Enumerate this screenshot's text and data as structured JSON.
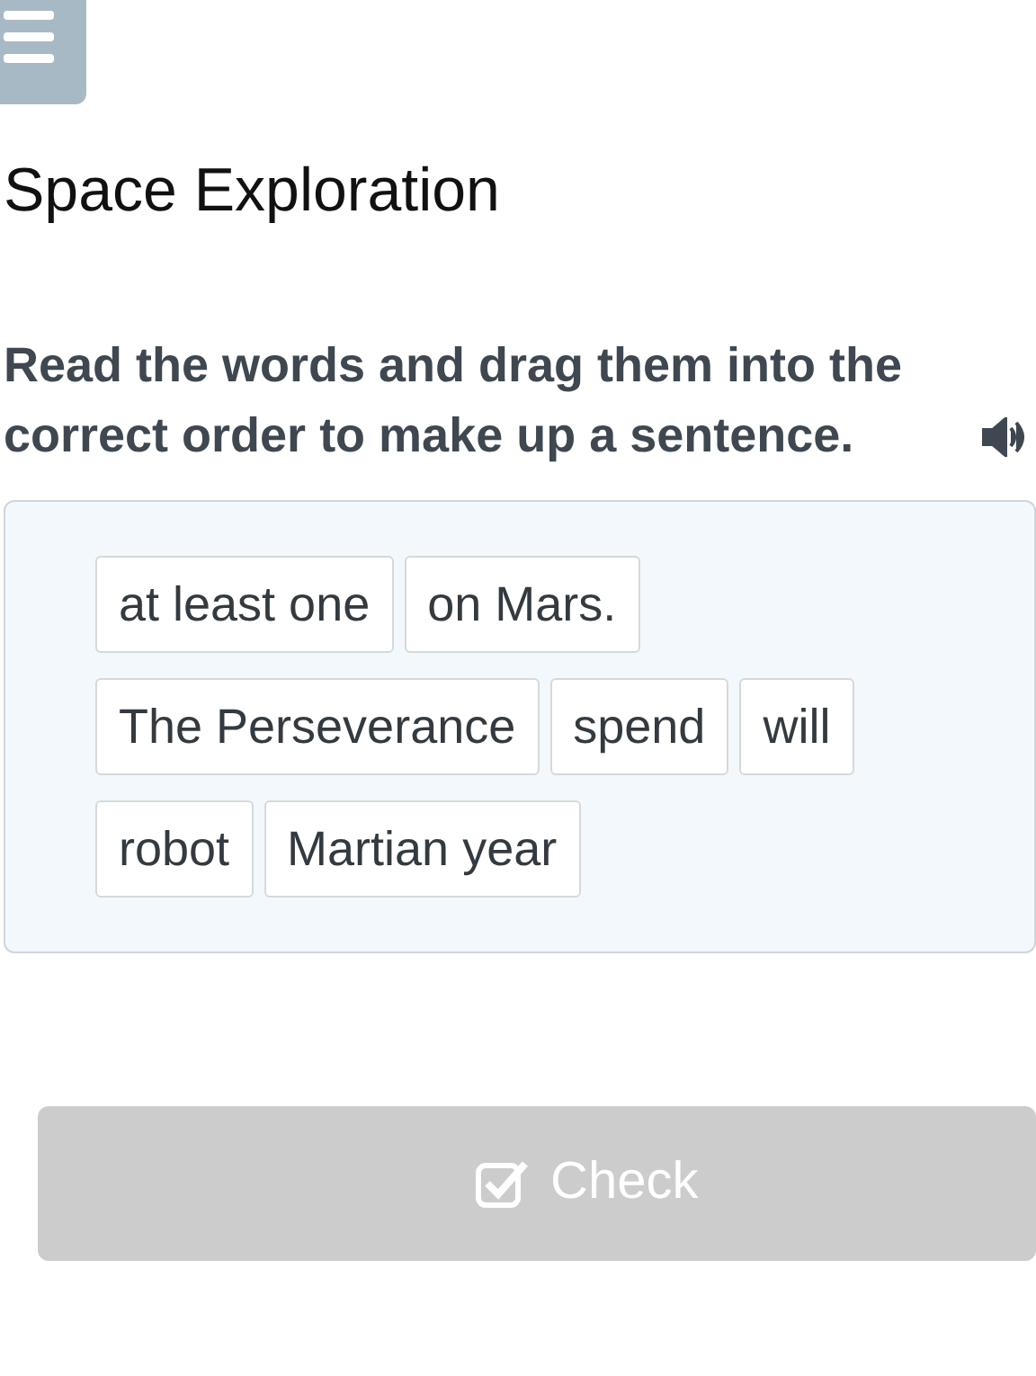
{
  "title": "Space Exploration",
  "instruction": "Read the words and drag them into the correct order to make up a sentence.",
  "word_rows": [
    [
      "at least one",
      "on Mars."
    ],
    [
      "The Perseverance",
      "spend",
      "will"
    ],
    [
      "robot",
      "Martian year"
    ]
  ],
  "check_button": {
    "label": "Check",
    "disabled": true
  }
}
